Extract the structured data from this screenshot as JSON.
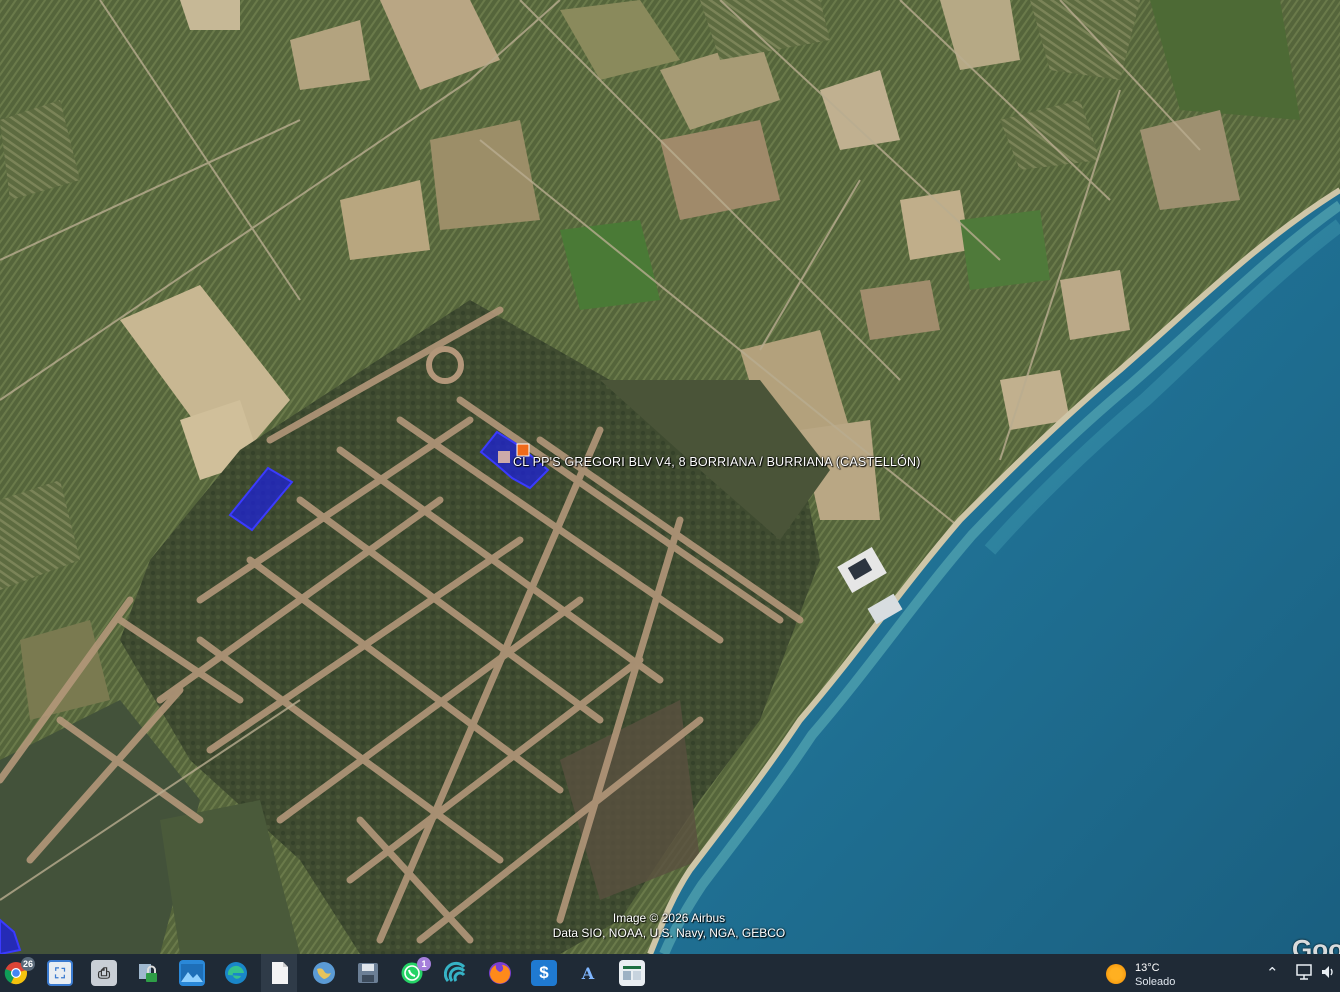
{
  "map": {
    "placemark_label": "CL PP'S GREGORI BLV V4, 8  BORRIANA / BURRIANA (CASTELLÓN)",
    "attribution_line1": "Image © 2026 Airbus",
    "attribution_line2": "Data SIO, NOAA, U.S. Navy, NGA, GEBCO",
    "logo_partial": "Goo",
    "parcel_color": "#1e22d6",
    "marker_color": "#f06a1a",
    "sea_color": "#1f6f92"
  },
  "taskbar": {
    "apps": [
      {
        "icon": "chrome-icon"
      },
      {
        "icon": "maps-app-icon"
      },
      {
        "icon": "printer-icon"
      },
      {
        "icon": "security-lock-icon"
      },
      {
        "icon": "photos-icon"
      },
      {
        "icon": "edge-icon"
      },
      {
        "icon": "file-icon"
      },
      {
        "icon": "google-earth-icon"
      },
      {
        "icon": "save-disk-icon"
      },
      {
        "icon": "whatsapp-icon",
        "badge": "1"
      },
      {
        "icon": "network-app-icon"
      },
      {
        "icon": "firefox-icon"
      },
      {
        "icon": "sync-app-icon"
      },
      {
        "icon": "font-app-icon"
      },
      {
        "icon": "spreadsheet-icon"
      }
    ],
    "chrome_badge": "26",
    "weather": {
      "temperature": "13°C",
      "condition": "Soleado"
    }
  }
}
